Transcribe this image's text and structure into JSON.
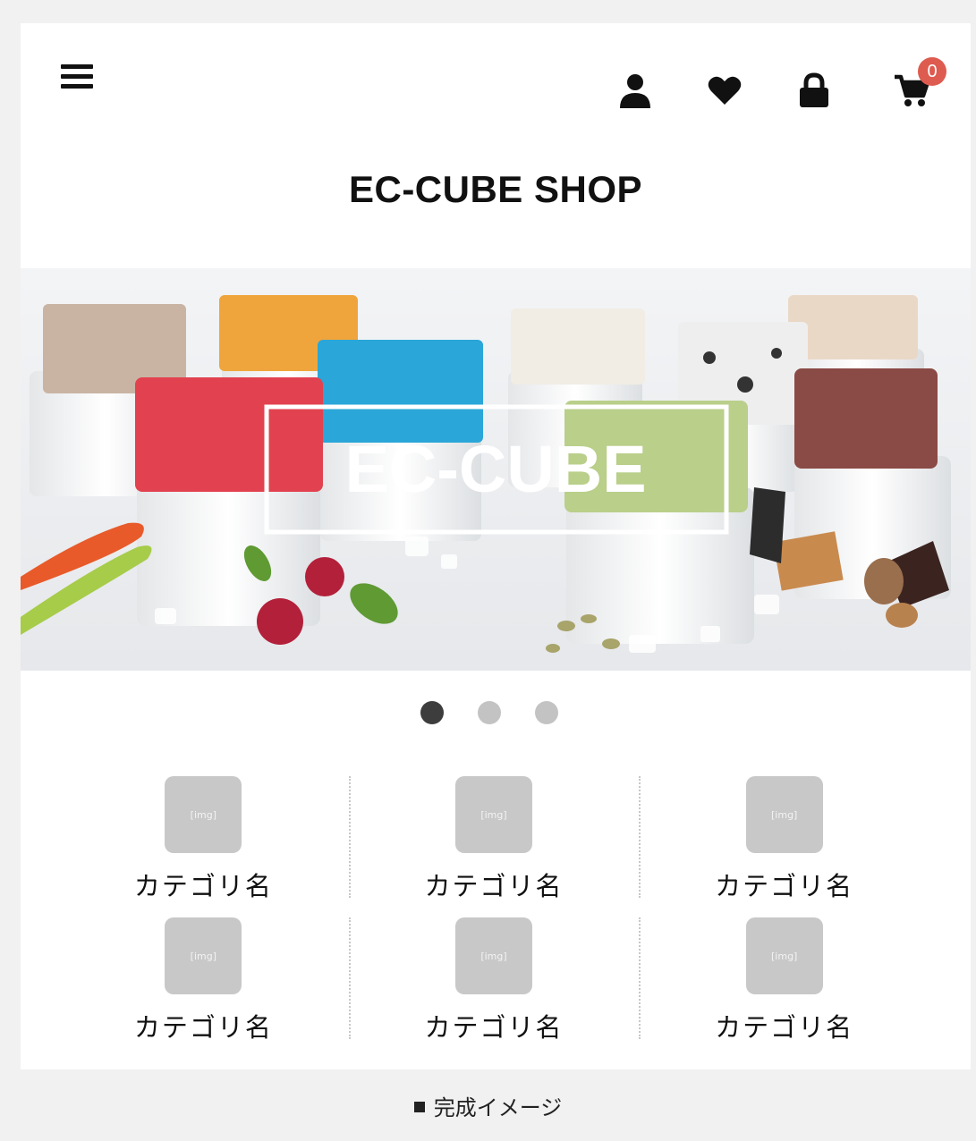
{
  "header": {
    "menu_icon": "hamburger-icon",
    "shop_title": "EC-CUBE SHOP",
    "icons": [
      {
        "name": "user-icon",
        "label": "mypage"
      },
      {
        "name": "heart-icon",
        "label": "favorites"
      },
      {
        "name": "lock-icon",
        "label": "login"
      },
      {
        "name": "cart-icon",
        "label": "cart"
      }
    ],
    "cart_count": "0",
    "badge_color": "#de5b4f"
  },
  "hero": {
    "logo_text": "EC-CUBE",
    "subject": "ice cream cubes in paper cups"
  },
  "slider": {
    "total": 3,
    "active": 1
  },
  "categories": [
    {
      "thumb": "[img]",
      "label": "カテゴリ名"
    },
    {
      "thumb": "[img]",
      "label": "カテゴリ名"
    },
    {
      "thumb": "[img]",
      "label": "カテゴリ名"
    },
    {
      "thumb": "[img]",
      "label": "カテゴリ名"
    },
    {
      "thumb": "[img]",
      "label": "カテゴリ名"
    },
    {
      "thumb": "[img]",
      "label": "カテゴリ名"
    }
  ],
  "caption": "完成イメージ"
}
